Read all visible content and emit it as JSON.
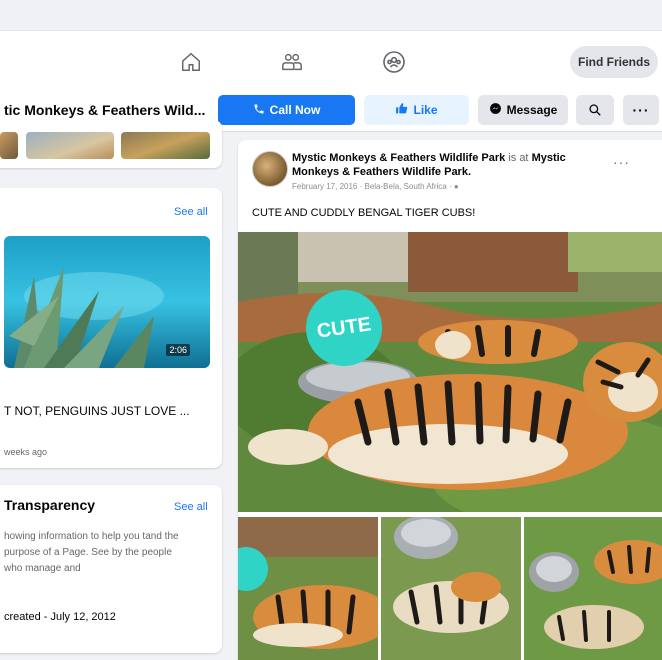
{
  "nav": {
    "find_friends": "Find Friends",
    "icons": [
      "home-icon",
      "friends-icon",
      "groups-icon"
    ]
  },
  "page_bar": {
    "page_name": "tic Monkeys & Feathers Wild...",
    "call_now": "Call Now",
    "like": "Like",
    "message": "Message"
  },
  "videos": {
    "see_all": "See all",
    "duration": "2:06",
    "title": "T NOT, PENGUINS JUST LOVE ...",
    "time": "weeks ago"
  },
  "transparency": {
    "title": "Transparency",
    "see_all": "See all",
    "description": "howing information to help you tand the purpose of a Page. See by the people who manage and",
    "created": "created - July 12, 2012"
  },
  "post": {
    "author": "Mystic Monkeys & Feathers Wildlife Park",
    "is_at": "is at",
    "location_name": "Mystic Monkeys & Feathers Wildlife Park.",
    "date": "February 17, 2016 · Bela-Bela, South Africa ·",
    "text": "CUTE AND CUDDLY BENGAL TIGER CUBS!",
    "sticker_text": "CUTE"
  },
  "colors": {
    "brand_blue": "#1877f2",
    "like_bg": "#e7f3ff",
    "sticker": "#2fd4c6"
  }
}
